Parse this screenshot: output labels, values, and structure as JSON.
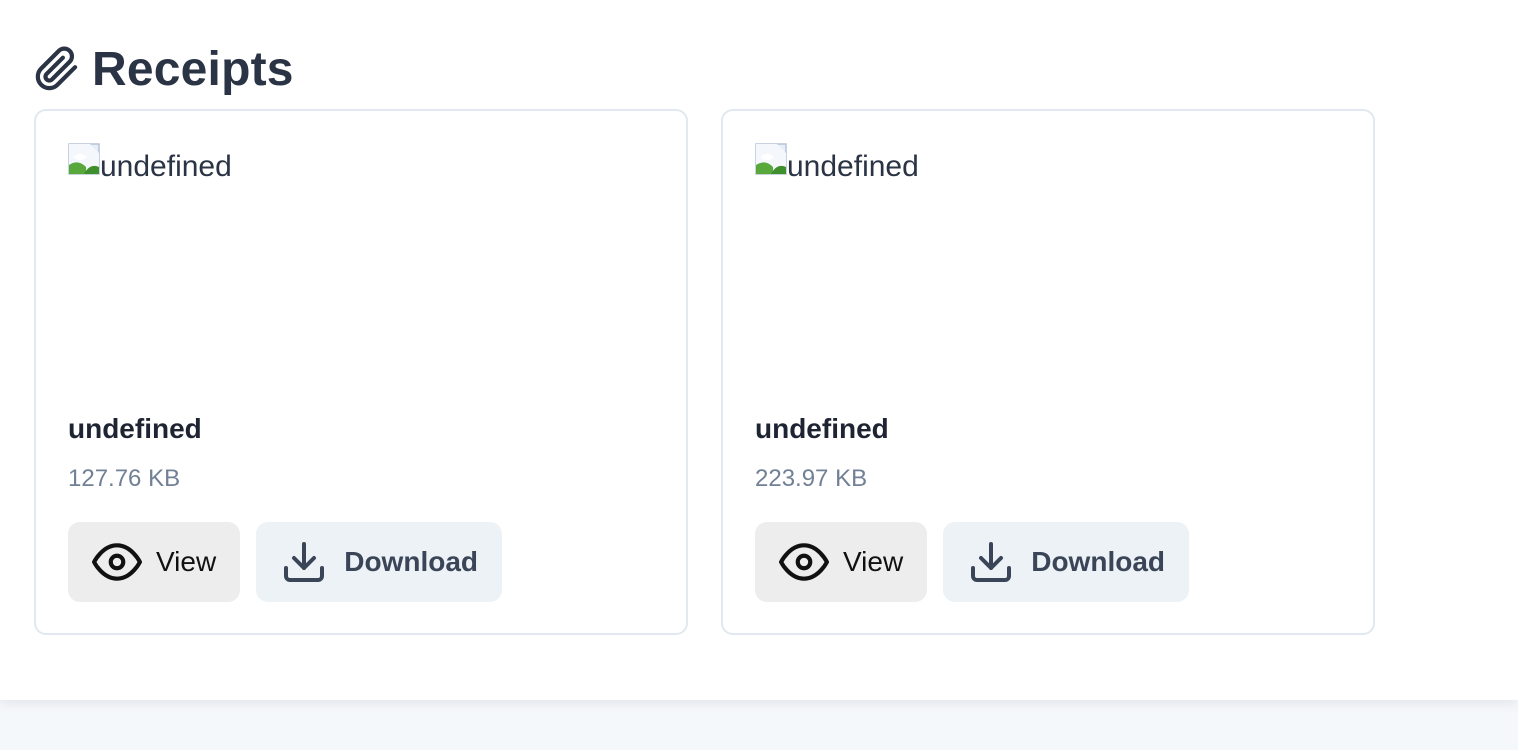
{
  "section": {
    "title": "Receipts",
    "icon": "paperclip-icon"
  },
  "receipts": [
    {
      "image_alt": "undefined",
      "name": "undefined",
      "size": "127.76 KB",
      "view_label": "View",
      "download_label": "Download"
    },
    {
      "image_alt": "undefined",
      "name": "undefined",
      "size": "223.97 KB",
      "view_label": "View",
      "download_label": "Download"
    }
  ],
  "colors": {
    "title": "#2b3445",
    "card_border": "#e2e8f0",
    "view_button_bg": "#ededed",
    "download_button_bg": "#edf2f7",
    "muted_text": "#718096",
    "page_bg": "#f5f8fb"
  }
}
